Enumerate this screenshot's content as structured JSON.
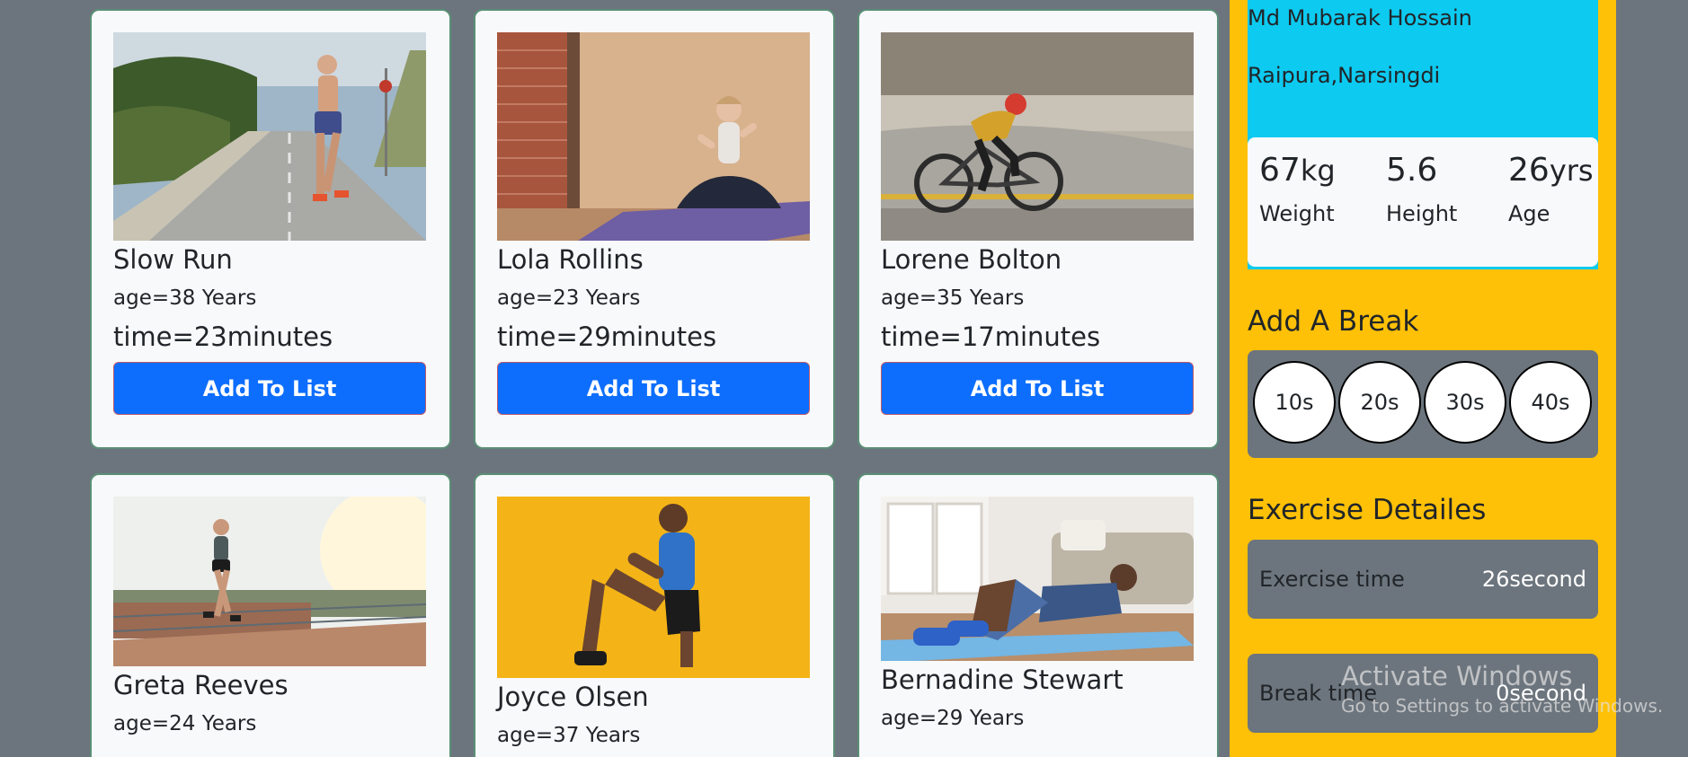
{
  "cards": [
    {
      "name": "Slow Run",
      "age": "age=38 Years",
      "time": "time=23minutes",
      "button": "Add To List",
      "image": "runner-on-road"
    },
    {
      "name": "Lola Rollins",
      "age": "age=23 Years",
      "time": "time=29minutes",
      "button": "Add To List",
      "image": "yoga-meditation"
    },
    {
      "name": "Lorene Bolton",
      "age": "age=35 Years",
      "time": "time=17minutes",
      "button": "Add To List",
      "image": "road-cyclist"
    },
    {
      "name": "Greta Reeves",
      "age": "age=24 Years",
      "image": "woman-jogging-track"
    },
    {
      "name": "Joyce Olsen",
      "age": "age=37 Years",
      "image": "man-stretching-yellow"
    },
    {
      "name": "Bernadine Stewart",
      "age": "age=29 Years",
      "image": "man-crunches-mat"
    }
  ],
  "profile": {
    "name": "Md Mubarak Hossain",
    "address": "Raipura,Narsingdi",
    "stats": [
      {
        "value": "67",
        "unit": "kg",
        "label": "Weight"
      },
      {
        "value": "5.6",
        "unit": "",
        "label": "Height"
      },
      {
        "value": "26",
        "unit": "yrs",
        "label": "Age"
      }
    ]
  },
  "break_section": {
    "title": "Add A Break",
    "options": [
      "10s",
      "20s",
      "30s",
      "40s"
    ]
  },
  "exercise_details": {
    "title": "Exercise Detailes",
    "exercise_label": "Exercise time",
    "exercise_value": "26second",
    "break_label": "Break time",
    "break_value": "0second"
  },
  "watermark": {
    "line1": "Activate Windows",
    "line2": "Go to Settings to activate Windows."
  },
  "colors": {
    "page_bg": "#6c757d",
    "card_bg": "#f8f9fa",
    "button_blue": "#0d6efd",
    "sidebar_yellow": "#ffc107",
    "profile_cyan": "#0dcaf0"
  }
}
